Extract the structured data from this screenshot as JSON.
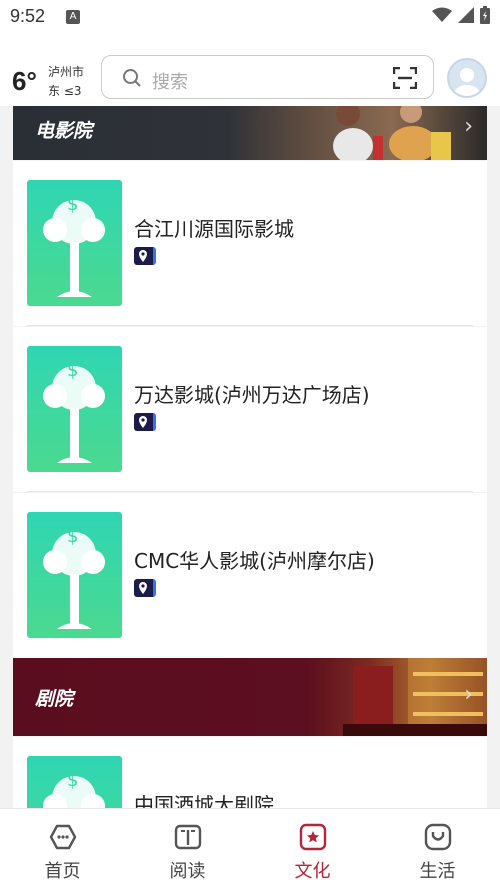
{
  "status_bar": {
    "time": "9:52",
    "app_icon": "A"
  },
  "header": {
    "temperature": "6°",
    "city": "泸州市",
    "wind": "东 ≤3",
    "search_placeholder": "搜索"
  },
  "sections": [
    {
      "title": "电影院",
      "items": [
        {
          "name": "合江川源国际影城"
        },
        {
          "name": "万达影城(泸州万达广场店)"
        },
        {
          "name": "CMC华人影城(泸州摩尔店)"
        }
      ]
    },
    {
      "title": "剧院",
      "items": [
        {
          "name": "中国酒城大剧院"
        }
      ]
    }
  ],
  "bottom_nav": [
    {
      "label": "首页",
      "icon": "home-icon",
      "active": false
    },
    {
      "label": "阅读",
      "icon": "book-icon",
      "active": false
    },
    {
      "label": "文化",
      "icon": "culture-icon",
      "active": true
    },
    {
      "label": "生活",
      "icon": "life-icon",
      "active": false
    }
  ],
  "colors": {
    "accent": "#b3263c",
    "thumb_top": "#2fd6b3",
    "thumb_bottom": "#4bd98f"
  }
}
